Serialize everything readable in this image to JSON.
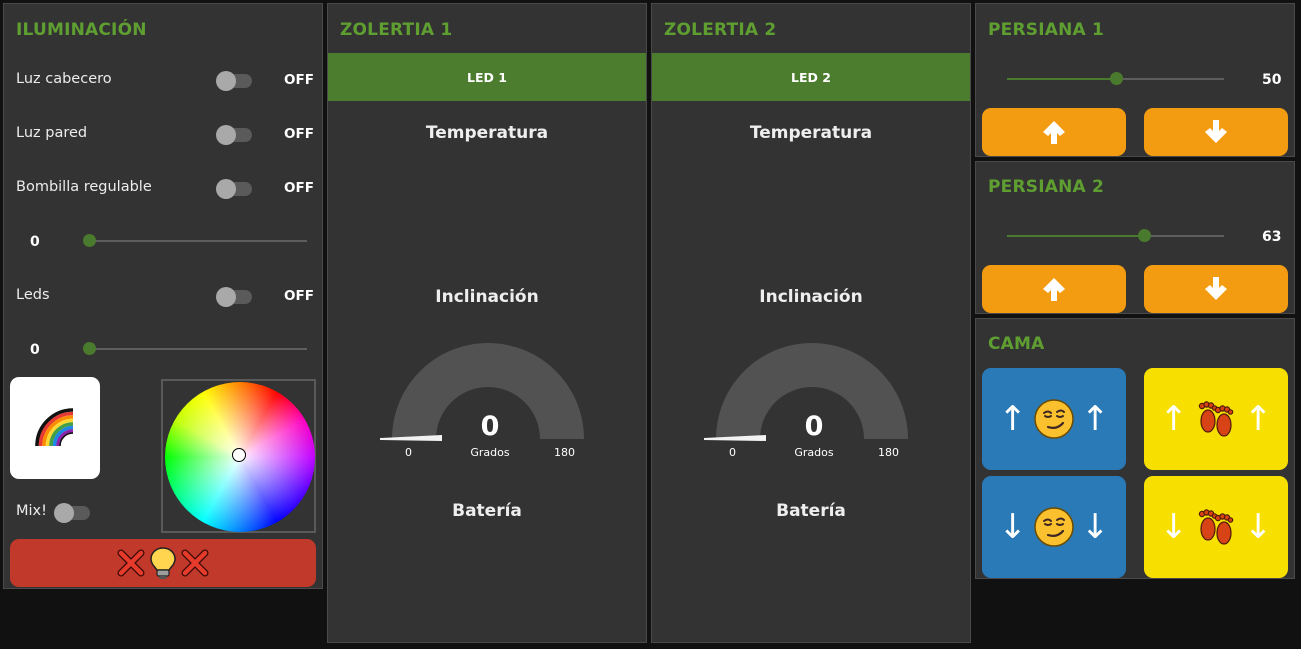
{
  "colors": {
    "background": "#111111",
    "panel": "#333333",
    "title_green": "#5f9e31",
    "led_bar_green": "#4c7c2e",
    "off_button_red": "#c0392b",
    "orange_button": "#f39c12",
    "cama_blue": "#2a7ab8",
    "cama_yellow": "#f7e000"
  },
  "iluminacion": {
    "title": "ILUMINACIÓN",
    "switches": [
      {
        "label": "Luz cabecero",
        "state": "OFF"
      },
      {
        "label": "Luz pared",
        "state": "OFF"
      },
      {
        "label": "Bombilla regulable",
        "state": "OFF"
      },
      {
        "label": "Leds",
        "state": "OFF"
      }
    ],
    "bombilla_level": {
      "value": "0",
      "fraction": 0
    },
    "leds_level": {
      "value": "0",
      "fraction": 0
    },
    "rainbow_button_icon": "rainbow-icon",
    "mix_label": "Mix!",
    "color_wheel_icon": "color-wheel",
    "off_all_button_icons": [
      "cross-mark-icon",
      "light-bulb-icon",
      "cross-mark-icon"
    ]
  },
  "zolertia1": {
    "title": "ZOLERTIA 1",
    "led_button": "LED 1",
    "temperature_title": "Temperatura",
    "inclination_title": "Inclinación",
    "gauge": {
      "value": "0",
      "unit": "Grados",
      "min": "0",
      "max": "180"
    },
    "battery_title": "Batería"
  },
  "zolertia2": {
    "title": "ZOLERTIA 2",
    "led_button": "LED 2",
    "temperature_title": "Temperatura",
    "inclination_title": "Inclinación",
    "gauge": {
      "value": "0",
      "unit": "Grados",
      "min": "0",
      "max": "180"
    },
    "battery_title": "Batería"
  },
  "persiana1": {
    "title": "PERSIANA 1",
    "value": "50",
    "fraction": 0.5,
    "up_icon": "arrow-up-icon",
    "down_icon": "arrow-down-icon"
  },
  "persiana2": {
    "title": "PERSIANA 2",
    "value": "63",
    "fraction": 0.63,
    "up_icon": "arrow-up-icon",
    "down_icon": "arrow-down-icon"
  },
  "cama": {
    "title": "CAMA",
    "buttons": [
      {
        "arrow": "↑",
        "icon": "smirking-face-icon",
        "color": "blue"
      },
      {
        "arrow": "↑",
        "icon": "footprints-icon",
        "color": "yellow"
      },
      {
        "arrow": "↓",
        "icon": "smirking-face-icon",
        "color": "blue"
      },
      {
        "arrow": "↓",
        "icon": "footprints-icon",
        "color": "yellow"
      }
    ]
  }
}
